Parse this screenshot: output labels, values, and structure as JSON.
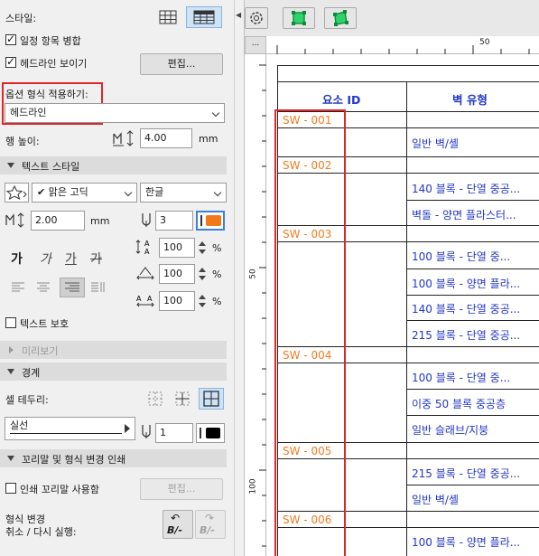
{
  "left_panel": {
    "style_label": "스타일:",
    "merge_label": "일정 항목 병합",
    "headline_show_label": "헤드라인 보이기",
    "edit_button": "편집...",
    "apply_format_label": "옵션 형식 적용하기:",
    "apply_format_value": "헤드라인",
    "row_height_label": "행 높이:",
    "row_height_value": "4.00",
    "row_height_unit": "mm",
    "text_style_section": "텍스트 스타일",
    "font_value": "맑은 고딕",
    "script_value": "한글",
    "text_size_value": "2.00",
    "text_size_unit": "mm",
    "pen_value": "3",
    "spacing_1": "100",
    "spacing_2": "100",
    "spacing_3": "100",
    "percent": "%",
    "bold_glyph": "가",
    "italic_glyph": "가",
    "underline_glyph": "가",
    "strike_glyph": "가",
    "text_protect_label": "텍스트 보호",
    "preview_section": "미리보기",
    "border_section": "경계",
    "cell_border_label": "셀 테두리:",
    "line_type_value": "실선",
    "border_pen_value": "1",
    "footer_section": "꼬리말 및 형식 변경 인쇄",
    "print_footer_label": "인쇄 꼬리말 사용함",
    "footer_edit_button": "편집...",
    "format_change_line1": "형식 변경",
    "format_change_line2": "취소 / 다시 실행:",
    "undo_glyph": "B/-",
    "redo_glyph": "B/-",
    "highlight_color": "#e0252a"
  },
  "toolbar": {
    "collapse_glyph": "◀",
    "gear_icon": "gear-icon",
    "select_icon": "square-select-icon",
    "transform_icon": "transform-icon",
    "accent_color": "#19c45a"
  },
  "ruler": {
    "corner": "...",
    "top_label": "50",
    "left_label_1": "50",
    "left_label_2": "100"
  },
  "schedule": {
    "header_id": "요소 ID",
    "header_type": "벽 유형",
    "rows": [
      {
        "id": "SW - 001",
        "items": [
          "일반 벽/셸"
        ]
      },
      {
        "id": "SW - 002",
        "items": [
          "140 블록 - 단열 중공...",
          "벽돌 - 양면 플라스터..."
        ]
      },
      {
        "id": "SW - 003",
        "items": [
          "100 블록 - 단열 중...",
          "100 블록 - 양면 플라...",
          "140 블록 - 단열 중공...",
          "215 블록 - 단열 중공..."
        ]
      },
      {
        "id": "SW - 004",
        "items": [
          "100 블록 - 단열 중...",
          "이중 50 블록 중공층",
          "일반 슬래브/지붕"
        ]
      },
      {
        "id": "SW - 005",
        "items": [
          "215 블록 - 단열 중공...",
          "일반 벽/셸"
        ]
      },
      {
        "id": "SW - 006",
        "items": [
          "100 블록 - 양면 플라..."
        ]
      }
    ],
    "id_color": "#f47a1f",
    "type_color": "#2237c8"
  }
}
